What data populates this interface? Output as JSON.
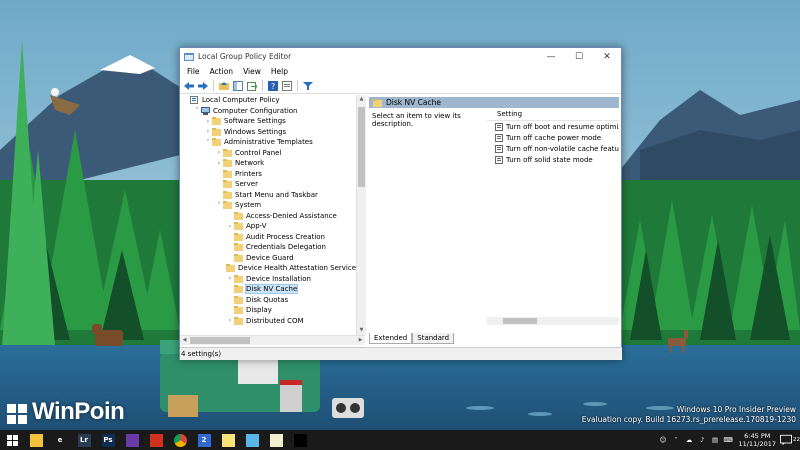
{
  "window": {
    "title": "Local Group Policy Editor",
    "controls": {
      "minimize": "—",
      "maximize": "☐",
      "close": "✕"
    }
  },
  "menu": [
    "File",
    "Action",
    "View",
    "Help"
  ],
  "tree": [
    {
      "label": "Local Computer Policy",
      "indent": 0,
      "expander": "",
      "icon": "policy-icon"
    },
    {
      "label": "Computer Configuration",
      "indent": 1,
      "expander": "˅",
      "icon": "computer-icon"
    },
    {
      "label": "Software Settings",
      "indent": 2,
      "expander": "›",
      "icon": "folder-icon"
    },
    {
      "label": "Windows Settings",
      "indent": 2,
      "expander": "›",
      "icon": "folder-icon"
    },
    {
      "label": "Administrative Templates",
      "indent": 2,
      "expander": "˅",
      "icon": "folder-icon"
    },
    {
      "label": "Control Panel",
      "indent": 3,
      "expander": "›",
      "icon": "folder-icon"
    },
    {
      "label": "Network",
      "indent": 3,
      "expander": "›",
      "icon": "folder-icon"
    },
    {
      "label": "Printers",
      "indent": 3,
      "expander": "",
      "icon": "folder-icon"
    },
    {
      "label": "Server",
      "indent": 3,
      "expander": "",
      "icon": "folder-icon"
    },
    {
      "label": "Start Menu and Taskbar",
      "indent": 3,
      "expander": "",
      "icon": "folder-icon"
    },
    {
      "label": "System",
      "indent": 3,
      "expander": "˅",
      "icon": "folder-icon"
    },
    {
      "label": "Access-Denied Assistance",
      "indent": 4,
      "expander": "",
      "icon": "folder-icon"
    },
    {
      "label": "App-V",
      "indent": 4,
      "expander": "›",
      "icon": "folder-icon"
    },
    {
      "label": "Audit Process Creation",
      "indent": 4,
      "expander": "",
      "icon": "folder-icon"
    },
    {
      "label": "Credentials Delegation",
      "indent": 4,
      "expander": "",
      "icon": "folder-icon"
    },
    {
      "label": "Device Guard",
      "indent": 4,
      "expander": "",
      "icon": "folder-icon"
    },
    {
      "label": "Device Health Attestation Service",
      "indent": 4,
      "expander": "",
      "icon": "folder-icon"
    },
    {
      "label": "Device Installation",
      "indent": 4,
      "expander": "›",
      "icon": "folder-icon"
    },
    {
      "label": "Disk NV Cache",
      "indent": 4,
      "expander": "",
      "icon": "folder-icon",
      "selected": true
    },
    {
      "label": "Disk Quotas",
      "indent": 4,
      "expander": "",
      "icon": "folder-icon"
    },
    {
      "label": "Display",
      "indent": 4,
      "expander": "",
      "icon": "folder-icon"
    },
    {
      "label": "Distributed COM",
      "indent": 4,
      "expander": "›",
      "icon": "folder-icon"
    }
  ],
  "right_pane": {
    "header": "Disk NV Cache",
    "description": "Select an item to view its description.",
    "column": "Setting",
    "settings": [
      "Turn off boot and resume optimizations",
      "Turn off cache power mode",
      "Turn off non-volatile cache feature",
      "Turn off solid state mode"
    ]
  },
  "tabs": [
    "Extended",
    "Standard"
  ],
  "status": "4 setting(s)",
  "desktop": {
    "brand": "WinPoin",
    "watermark_line1": "Windows 10 Pro Insider Preview",
    "watermark_line2": "Evaluation copy. Build 16273.rs_prerelease.170819-1230"
  },
  "taskbar": {
    "apps": [
      {
        "name": "windows-start-icon",
        "label": "",
        "color": "#1a1a1a"
      },
      {
        "name": "file-explorer-icon",
        "label": "",
        "color": "#f3c13a"
      },
      {
        "name": "edge-icon",
        "label": "e",
        "color": "#1a1a1a"
      },
      {
        "name": "lightroom-icon",
        "label": "Lr",
        "color": "#2b3d55"
      },
      {
        "name": "photoshop-icon",
        "label": "Ps",
        "color": "#0f2d52"
      },
      {
        "name": "visual-studio-icon",
        "label": "",
        "color": "#6a3ba8"
      },
      {
        "name": "record-icon",
        "label": "",
        "color": "#d0321e"
      },
      {
        "name": "chrome-icon",
        "label": "",
        "color": "#ffffff"
      },
      {
        "name": "messenger-icon",
        "label": "2",
        "color": "#2f6bd1"
      },
      {
        "name": "notes-icon",
        "label": "",
        "color": "#f8e27a"
      },
      {
        "name": "app-icon",
        "label": "",
        "color": "#5ab5e8"
      },
      {
        "name": "notepad-icon",
        "label": "",
        "color": "#f0f0d0"
      },
      {
        "name": "cmd-icon",
        "label": "",
        "color": "#000000"
      }
    ],
    "time": "6:45 PM",
    "date": "11/11/2017",
    "notifications": "22"
  }
}
